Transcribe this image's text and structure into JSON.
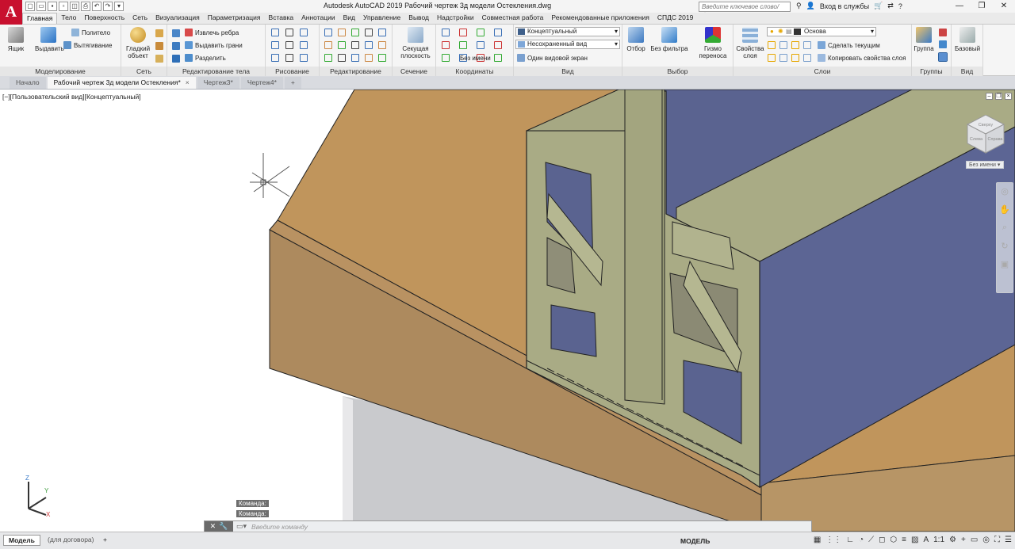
{
  "app": {
    "logo": "A",
    "title": "Autodesk AutoCAD 2019    Рабочий чертеж 3д модели Остекления.dwg",
    "search_placeholder": "Введите ключевое слово/фразу",
    "login": "Вход в службы",
    "accent": "#c8102e"
  },
  "ribbon_tabs": [
    "Главная",
    "Тело",
    "Поверхность",
    "Сеть",
    "Визуализация",
    "Параметризация",
    "Вставка",
    "Аннотации",
    "Вид",
    "Управление",
    "Вывод",
    "Надстройки",
    "Совместная работа",
    "Рекомендованные приложения",
    "СПДС 2019"
  ],
  "panels": {
    "modeling": {
      "label": "Моделирование",
      "box": "Ящик",
      "extrude": "Выдавить",
      "polysolid": "Политело",
      "presspull": "Вытягивание"
    },
    "mesh": {
      "label": "Сеть",
      "smooth": "Гладкий объект"
    },
    "solid_edit": {
      "label": "Редактирование тела",
      "extract_edges": "Извлечь ребра",
      "extrude_faces": "Выдавить грани",
      "separate": "Разделить"
    },
    "draw": {
      "label": "Рисование"
    },
    "modify": {
      "label": "Редактирование"
    },
    "section": {
      "label": "Сечение",
      "plane": "Секущая плоскость"
    },
    "coords": {
      "label": "Координаты",
      "unnamed": "Без имени"
    },
    "view": {
      "label": "Вид",
      "visual_style": "Концептуальный",
      "saved_view": "Несохраненный вид",
      "single_vp": "Один видовой экран"
    },
    "selection": {
      "label": "Выбор",
      "culling": "Отбор",
      "no_filter": "Без фильтра",
      "gizmo": "Гизмо переноса"
    },
    "layers": {
      "label": "Слои",
      "props": "Свойства слоя",
      "layer_name": "Основа",
      "make_current": "Сделать текущим",
      "match": "Копировать свойства слоя"
    },
    "groups": {
      "label": "Группы",
      "group": "Группа"
    },
    "view2": {
      "label": "Вид",
      "base": "Базовый"
    }
  },
  "doc_tabs": [
    {
      "label": "Начало",
      "active": false
    },
    {
      "label": "Рабочий чертеж 3д модели Остекления*",
      "active": true
    },
    {
      "label": "Чертеж3*",
      "active": false
    },
    {
      "label": "Чертеж4*",
      "active": false
    }
  ],
  "viewport": {
    "label": "[−][Пользовательский вид][Концептуальный]",
    "cube_name": "Без имени",
    "cube_faces": [
      "Сверху",
      "Слева",
      "Справа"
    ]
  },
  "command": {
    "history": [
      "Команда:",
      "Команда:"
    ],
    "placeholder": "Введите команду"
  },
  "status": {
    "tabs": [
      "Модель",
      "(для договора)"
    ],
    "model": "МОДЕЛЬ",
    "scale": "1:1"
  },
  "colors": {
    "wood": "#c0955c",
    "wood_dark": "#ad8a5e",
    "profile": "#a9ab85",
    "glass": "#5a6390"
  }
}
